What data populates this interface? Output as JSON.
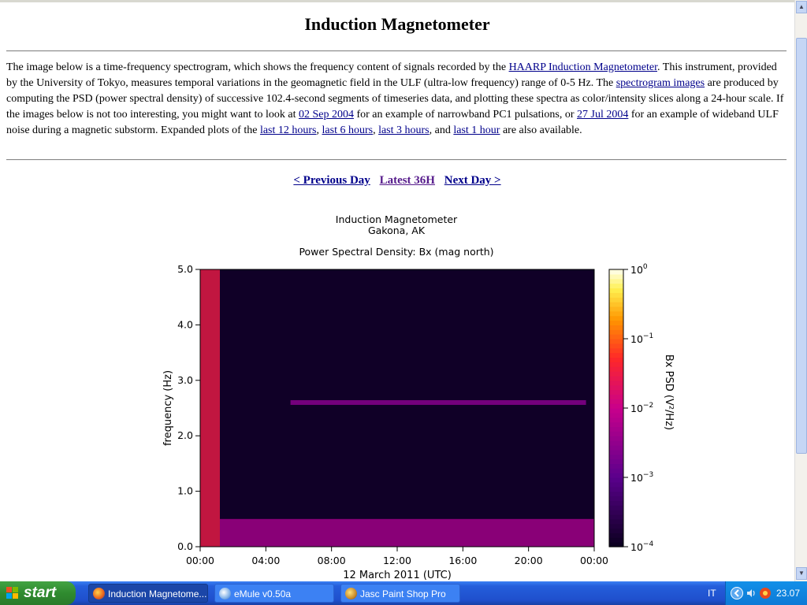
{
  "page": {
    "title": "Induction Magnetometer",
    "intro": [
      {
        "t": "The image below is a time-frequency spectrogram, which shows the frequency content of signals recorded by the "
      },
      {
        "link": "HAARP Induction Magnetometer"
      },
      {
        "t": ". This instrument, provided by the University of Tokyo, measures temporal variations in the geomagnetic field in the ULF (ultra-low frequency) range of 0-5 Hz. The "
      },
      {
        "link": "spectrogram images"
      },
      {
        "t": " are produced by computing the PSD (power spectral density) of successive 102.4-second segments of timeseries data, and plotting these spectra as color/intensity slices along a 24-hour scale. If the images below is not too interesting, you might want to look at "
      },
      {
        "link": "02 Sep 2004"
      },
      {
        "t": " for an example of narrowband PC1 pulsations, or "
      },
      {
        "link": "27 Jul 2004"
      },
      {
        "t": " for an example of wideband ULF noise during a magnetic substorm. Expanded plots of the "
      },
      {
        "link": "last 12 hours"
      },
      {
        "t": ", "
      },
      {
        "link": "last 6 hours"
      },
      {
        "t": ", "
      },
      {
        "link": "last 3 hours"
      },
      {
        "t": ", and "
      },
      {
        "link": "last 1 hour"
      },
      {
        "t": " are also available."
      }
    ],
    "nav": {
      "prev": "< Previous Day",
      "latest": "Latest 36H",
      "next": "Next Day >"
    }
  },
  "chart_data": {
    "type": "heatmap",
    "title": "Induction Magnetometer",
    "subtitle": "Gakona, AK",
    "plot_title": "Power Spectral Density: Bx (mag north)",
    "xlabel": "12 March 2011 (UTC)",
    "ylabel": "frequency (Hz)",
    "x_ticks": [
      "00:00",
      "04:00",
      "08:00",
      "12:00",
      "16:00",
      "20:00",
      "00:00"
    ],
    "x_range_hours": [
      0,
      24
    ],
    "y_ticks": [
      "0.0",
      "1.0",
      "2.0",
      "3.0",
      "4.0",
      "5.0"
    ],
    "y_range": [
      0,
      5
    ],
    "colorbar": {
      "label": "Bx PSD (V²/Hz)",
      "ticks": [
        {
          "base": "10",
          "exp": "0"
        },
        {
          "base": "10",
          "exp": "−1"
        },
        {
          "base": "10",
          "exp": "−2"
        },
        {
          "base": "10",
          "exp": "−3"
        },
        {
          "base": "10",
          "exp": "−4"
        }
      ],
      "range_log10": [
        -4,
        0
      ]
    },
    "features": [
      {
        "desc": "strong low-frequency noise",
        "t_start": 0,
        "t_end": 1.2,
        "f_max": 5.0,
        "level": -1.5
      },
      {
        "desc": "narrowband band near 2.6 Hz",
        "t_start": 5.5,
        "t_end": 23.5,
        "f": 2.6,
        "level": -2.6
      },
      {
        "desc": "broadband noise below 0.5 Hz",
        "t_start": 1.2,
        "t_end": 24,
        "f_max": 0.5,
        "level": -2.3
      }
    ]
  },
  "scrollbar": {
    "thumb": "scroll-thumb"
  },
  "taskbar": {
    "start": "start",
    "tasks": [
      {
        "label": "Induction Magnetome...",
        "icon": "firefox-icon",
        "active": true
      },
      {
        "label": "eMule v0.50a",
        "icon": "emule-icon",
        "active": false
      },
      {
        "label": "Jasc Paint Shop Pro",
        "icon": "paintshop-icon",
        "active": false
      }
    ],
    "lang": "IT",
    "clock": "23.07"
  },
  "colors": {
    "link": "#00008b",
    "taskbar": "#245edb",
    "start": "#2f8b2f"
  }
}
